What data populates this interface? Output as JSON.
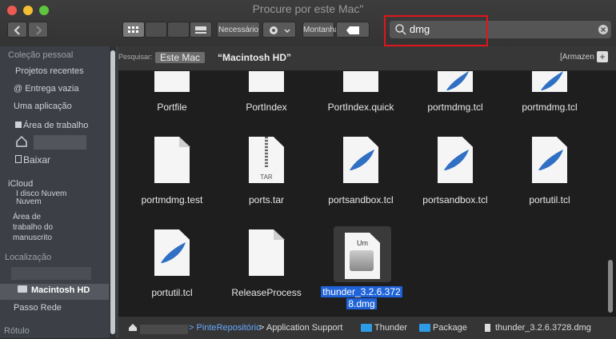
{
  "window": {
    "title": "Procure por este Mac\""
  },
  "toolbar": {
    "back_icon": "chevron-left-icon",
    "forward_icon": "chevron-right-icon",
    "necessario_label": "Necessário",
    "montanha_label": "Montanha",
    "search_value": "dmg"
  },
  "sidebar": {
    "section_personal": "Coleção pessoal",
    "items": [
      {
        "label": "Projetos recentes"
      },
      {
        "label": "@ Entrega vazia"
      },
      {
        "label": "Uma aplicação"
      },
      {
        "label": "Área de trabalho"
      },
      {
        "label": ""
      },
      {
        "label": "Baixar"
      }
    ],
    "icloud_head": "iCloud",
    "icloud_drive": "I disco Nuvem\nNuvem",
    "desktop_docs": "Área de\ntrabalho do\nmanuscrito",
    "locations_head": "Localização",
    "macintosh": "Macintosh HD",
    "network": "Passo Rede",
    "tags_head": "Rótulo"
  },
  "scopebar": {
    "search_label": "Pesquisar:",
    "this_mac": "Este Mac",
    "macintosh": "“Macintosh HD”",
    "save": "[Armazen"
  },
  "files": [
    {
      "name": "Portfile",
      "kind": "doc"
    },
    {
      "name": "PortIndex",
      "kind": "doc"
    },
    {
      "name": "PortIndex.quick",
      "kind": "doc"
    },
    {
      "name": "portmdmg.tcl",
      "kind": "tcl"
    },
    {
      "name": "portmdmg.tcl",
      "kind": "tcl"
    },
    {
      "name": "portmdmg.test",
      "kind": "doc"
    },
    {
      "name": "ports.tar",
      "kind": "tar",
      "badge": "TAR"
    },
    {
      "name": "portsandbox.tcl",
      "kind": "tcl"
    },
    {
      "name": "portsandbox.tcl",
      "kind": "tcl"
    },
    {
      "name": "portutil.tcl",
      "kind": "tcl"
    },
    {
      "name": "portutil.tcl",
      "kind": "tcl"
    },
    {
      "name": "ReleaseProcess",
      "kind": "doc"
    },
    {
      "name": "thunder_3.2.6.3728.dmg",
      "kind": "dmg",
      "badge": "Um",
      "line1": "thunder_3.2.6.372",
      "line2": "8.dmg"
    }
  ],
  "pathbar": {
    "seg1": "> Pinte",
    "seg1b": "Repositório",
    "seg2": "> Application Support",
    "seg3": "Thunder",
    "seg4": "Package",
    "seg5": "thunder_3.2.6.3728.dmg"
  },
  "colors": {
    "accent": "#2063d9",
    "folder": "#2e9be6",
    "highlight": "#e0161b"
  }
}
